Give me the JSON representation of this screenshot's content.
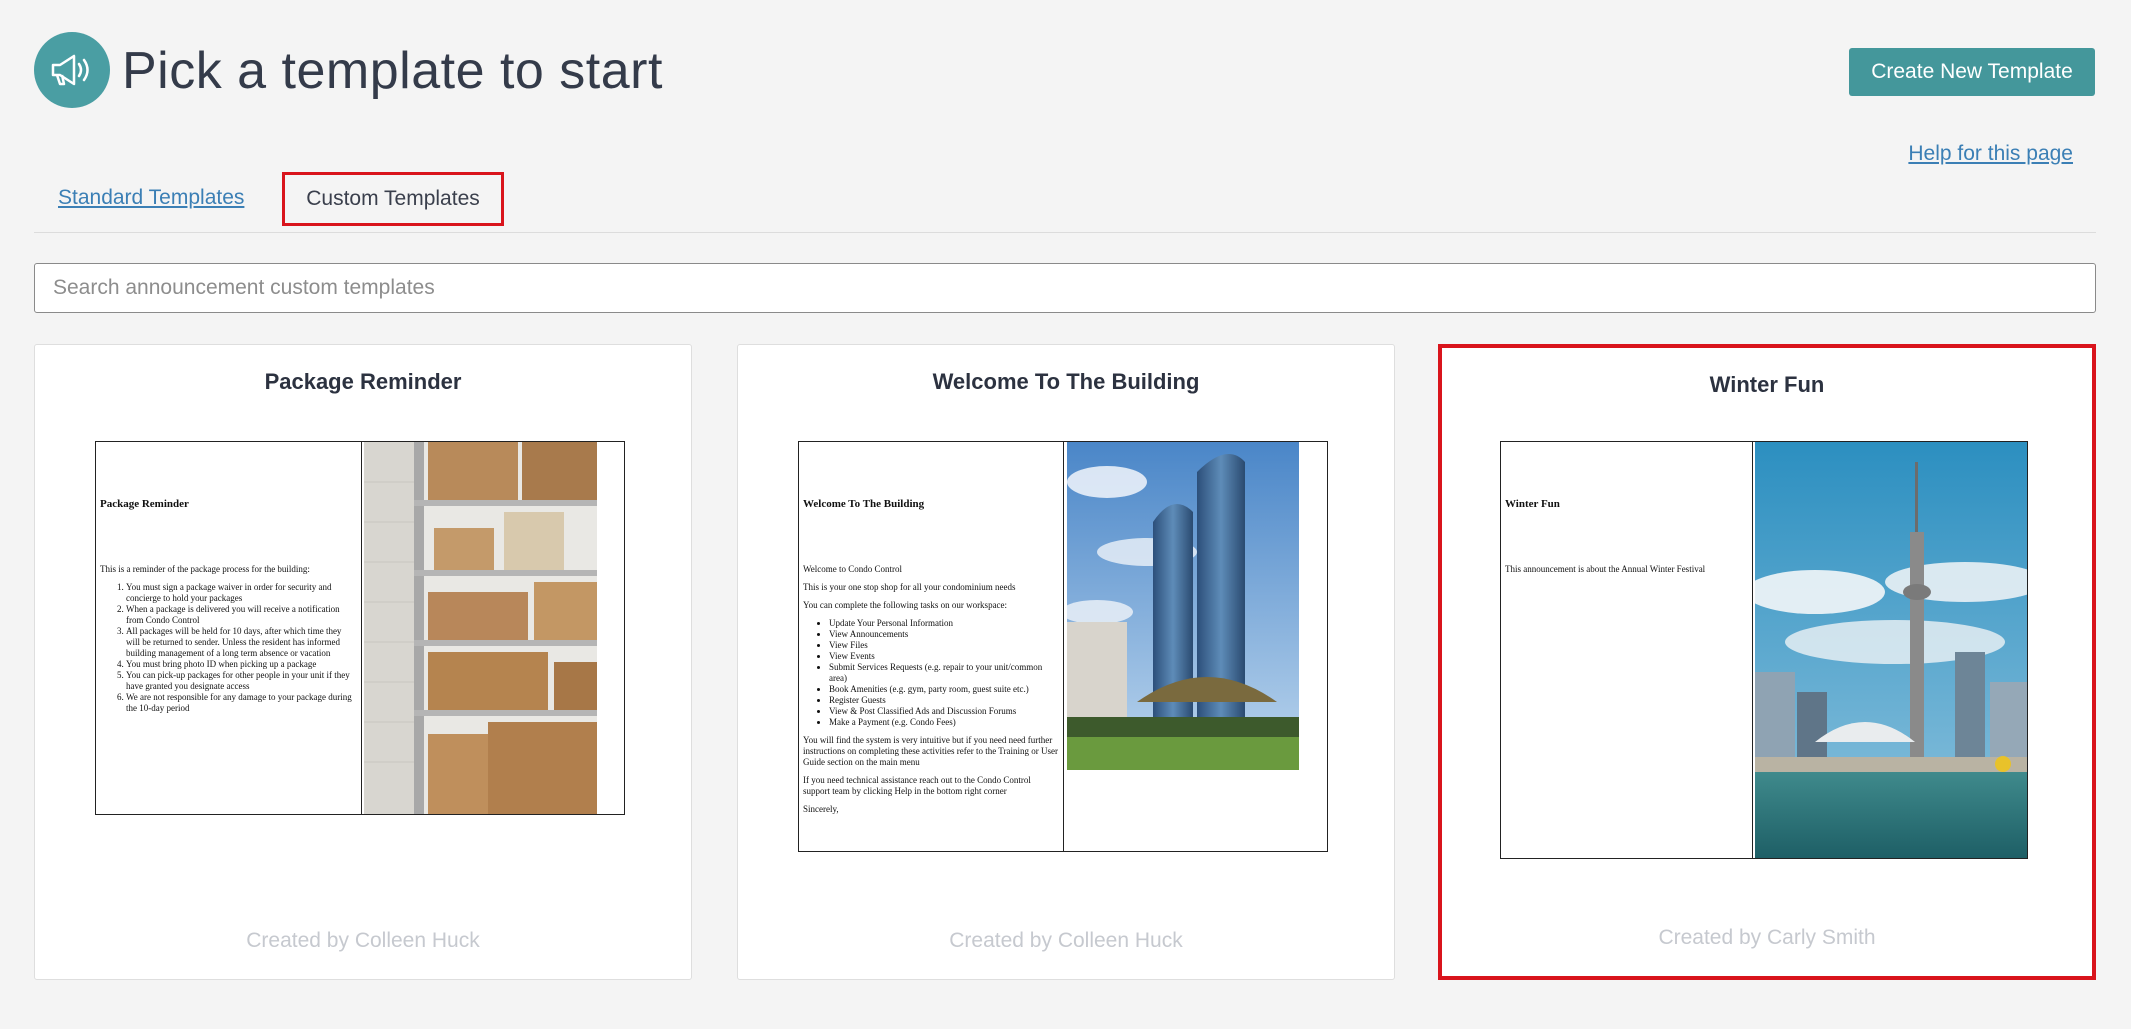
{
  "header": {
    "title": "Pick a template to start",
    "create_button": "Create New Template",
    "help_link": "Help for this page",
    "logo_icon": "megaphone-icon"
  },
  "tabs": {
    "standard": "Standard Templates",
    "custom": "Custom Templates",
    "active": "custom"
  },
  "search": {
    "placeholder": "Search announcement custom templates",
    "value": ""
  },
  "colors": {
    "accent": "#44979b",
    "selection": "#d9141c",
    "link": "#3b7fb5"
  },
  "cards": [
    {
      "title": "Package Reminder",
      "author": "Created by Colleen Huck",
      "selected": false,
      "preview": {
        "heading": "Package Reminder",
        "intro": "This is a reminder of the package process for the building:",
        "list": [
          "You must sign a package waiver in order for security and concierge to hold your packages",
          "When a package is delivered you will receive a notification from Condo Control",
          "All packages will be held for 10 days, after which time they will be returned to sender. Unless the resident has informed building management of a long term absence or vacation",
          "You must bring photo ID when picking up a package",
          "You can pick-up packages for other people in your unit if they have granted you designate access",
          "We are not responsible for any damage to your package during the 10-day period"
        ],
        "image": "package-shelf-photo"
      }
    },
    {
      "title": "Welcome To The Building",
      "author": "Created by Colleen Huck",
      "selected": false,
      "preview": {
        "heading": "Welcome To The Building",
        "p1": "Welcome to Condo Control",
        "p2": "This is your one stop shop for all your condominium needs",
        "p3": "You can complete the following tasks on our workspace:",
        "list": [
          "Update Your Personal Information",
          "View Announcements",
          "View Files",
          "View Events",
          "Submit Services Requests (e.g. repair to your unit/common area)",
          "Book Amenities (e.g. gym, party room, guest suite etc.)",
          "Register Guests",
          "View & Post Classified Ads and Discussion Forums",
          "Make a Payment (e.g. Condo Fees)"
        ],
        "p4": "You will find the system is very intuitive but if you need need further instructions on completing these activities refer to the Training or User Guide section on the main menu",
        "p5": "If you need technical assistance reach out to the Condo Control support team by clicking Help in the bottom right corner",
        "p6": "Sincerely,",
        "image": "glass-towers-photo"
      }
    },
    {
      "title": "Winter Fun",
      "author": "Created by Carly Smith",
      "selected": true,
      "preview": {
        "heading": "Winter Fun",
        "p1": "This announcement is about the Annual Winter Festival",
        "image": "toronto-skyline-photo"
      }
    }
  ]
}
